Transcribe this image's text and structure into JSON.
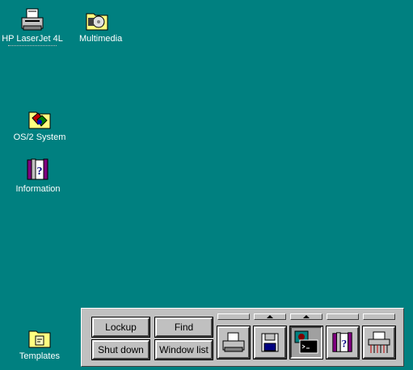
{
  "desktop": {
    "icons": [
      {
        "label": "HP LaserJet 4L",
        "icon": "printer-icon"
      },
      {
        "label": "Multimedia",
        "icon": "multimedia-folder-icon"
      },
      {
        "label": "OS/2 System",
        "icon": "system-folder-icon"
      },
      {
        "label": "Information",
        "icon": "information-folder-icon"
      },
      {
        "label": "Templates",
        "icon": "templates-folder-icon"
      }
    ]
  },
  "launchpad": {
    "buttons": {
      "lockup": "Lockup",
      "find": "Find",
      "shutdown": "Shut down",
      "windowlist": "Window list"
    },
    "objects": [
      {
        "name": "printer-icon"
      },
      {
        "name": "drives-icon"
      },
      {
        "name": "command-prompt-icon"
      },
      {
        "name": "help-icon"
      },
      {
        "name": "shredder-icon"
      }
    ]
  }
}
